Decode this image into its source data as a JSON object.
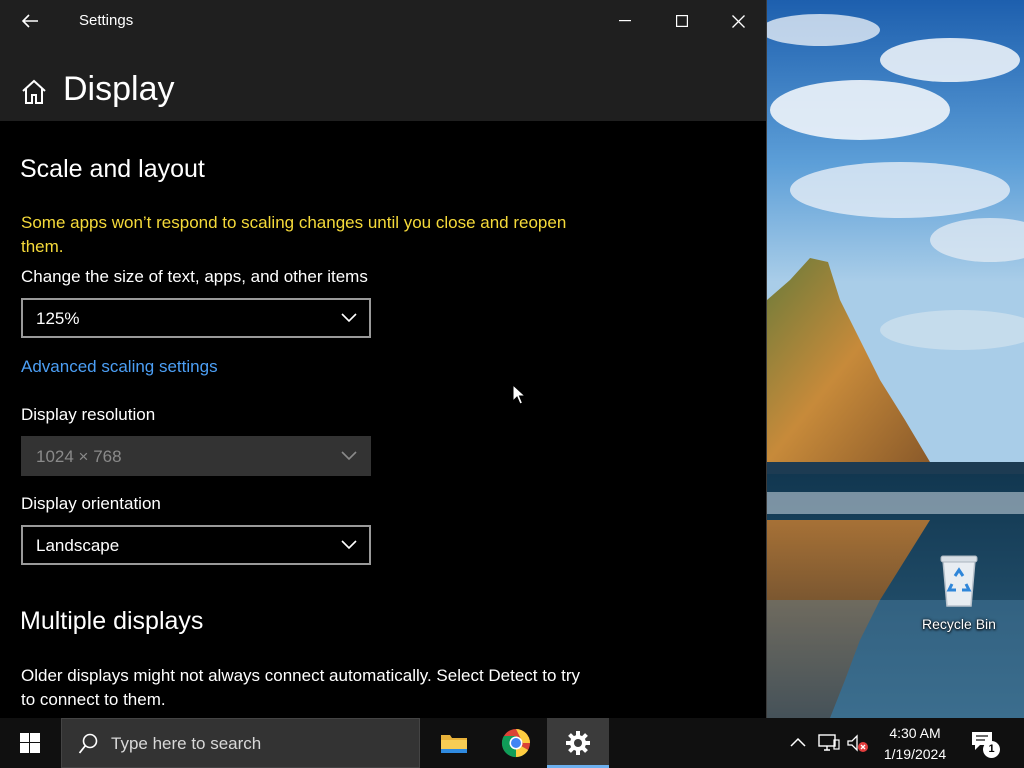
{
  "window": {
    "title": "Settings",
    "page_title": "Display"
  },
  "scale_and_layout": {
    "heading": "Scale and layout",
    "warning": "Some apps won’t respond to scaling changes until you close and reopen them.",
    "size_label": "Change the size of text, apps, and other items",
    "size_value": "125%",
    "advanced_link": "Advanced scaling settings",
    "resolution_label": "Display resolution",
    "resolution_value": "1024 × 768",
    "orientation_label": "Display orientation",
    "orientation_value": "Landscape"
  },
  "multiple_displays": {
    "heading": "Multiple displays",
    "description": "Older displays might not always connect automatically. Select Detect to try to connect to them."
  },
  "desktop": {
    "recycle_bin_label": "Recycle Bin"
  },
  "taskbar": {
    "search_placeholder": "Type here to search",
    "apps": [
      "file-explorer-icon",
      "chrome-icon",
      "settings-gear-icon"
    ],
    "active_app": "Settings",
    "clock_time": "4:30 AM",
    "clock_date": "1/19/2024",
    "notification_count": "1"
  },
  "colors": {
    "warning": "#f5da3a",
    "link": "#4c9ff5",
    "accent": "#6db0ef",
    "window_bg": "#000000",
    "header_bg": "#1f1f1f"
  }
}
